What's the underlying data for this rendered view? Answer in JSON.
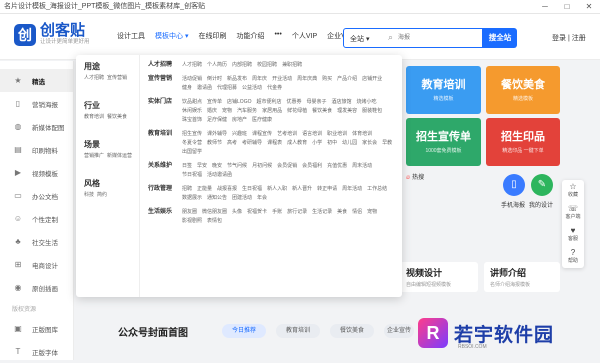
{
  "window": {
    "title": "名片设计模板_海报设计_PPT模板_微信图片_模板素材库_创客贴",
    "min": "─",
    "max": "□",
    "close": "✕"
  },
  "logo": {
    "mark": "创",
    "name": "创客贴",
    "slogan": "让设计更简单更好用"
  },
  "nav": [
    {
      "label": "设计工具"
    },
    {
      "label": "模板中心 ▾",
      "active": true
    },
    {
      "label": "在线印刷"
    },
    {
      "label": "功能介绍"
    },
    {
      "label": "•••"
    },
    {
      "label": "个人VIP"
    },
    {
      "label": "企业VIP"
    }
  ],
  "search": {
    "scope": "全站 ▾",
    "placeholder": "海报",
    "button": "搜全站"
  },
  "account": {
    "login": "登录",
    "sep": "|",
    "register": "注册"
  },
  "sidebar": {
    "items": [
      {
        "icon": "★",
        "label": "精选",
        "active": true
      },
      {
        "icon": "▯",
        "label": "营销海报"
      },
      {
        "icon": "◍",
        "label": "新媒体配图"
      },
      {
        "icon": "▤",
        "label": "印刷物料"
      },
      {
        "icon": "▶",
        "label": "视频模板"
      },
      {
        "icon": "▭",
        "label": "办公文档"
      },
      {
        "icon": "☺",
        "label": "个性定制"
      },
      {
        "icon": "♣",
        "label": "社交生活"
      },
      {
        "icon": "⊞",
        "label": "电商设计"
      },
      {
        "icon": "◉",
        "label": "原创插画"
      }
    ],
    "sub_title": "版权资源",
    "sub_items": [
      {
        "icon": "▣",
        "label": "正版图库"
      },
      {
        "icon": "T",
        "label": "正版字体"
      }
    ]
  },
  "menu": {
    "categories": [
      {
        "title": "用途",
        "subs": [
          "人才招聘",
          "宣传营销"
        ]
      },
      {
        "title": "行业",
        "subs": [
          "教育培训",
          "餐饮美食"
        ]
      },
      {
        "title": "场景",
        "subs": [
          "营销推广",
          "新媒体运营"
        ]
      },
      {
        "title": "风格",
        "subs": [
          "科技",
          "简约"
        ]
      }
    ],
    "groups": [
      {
        "title": "人才招聘",
        "items": [
          "人才招聘",
          "个人简历",
          "内部招聘",
          "校园招聘",
          "兼职招聘"
        ]
      },
      {
        "title": "宣传营销",
        "items": [
          "活动促销",
          "倒计时",
          "新品发布",
          "周年庆",
          "开业活动",
          "周年庆典",
          "购买",
          "产品介绍",
          "店铺开业",
          "健身",
          "邀请函",
          "代理招募",
          "公益活动",
          "代金券"
        ]
      },
      {
        "title": "实体门店",
        "items": [
          "饮品甜点",
          "宣传单",
          "店铺LOGO",
          "超市便利店",
          "优惠券",
          "母婴亲子",
          "酒店旅馆",
          "烧烤小吃",
          "休闲娱乐",
          "婚庆",
          "宠物",
          "汽车服务",
          "家居用品",
          "鲜花绿植",
          "餐饮美食",
          "理发美容",
          "服装鞋包",
          "珠宝首饰",
          "足疗保健",
          "房地产",
          "医疗健康"
        ]
      },
      {
        "title": "教育培训",
        "items": [
          "招生宣传",
          "课外辅导",
          "兴趣班",
          "课程宣传",
          "艺考培训",
          "语言培训",
          "职业培训",
          "体育培训",
          "冬夏令营",
          "教师节",
          "高考",
          "考研辅导",
          "课程表",
          "成人教育",
          "小学",
          "初中",
          "幼儿园",
          "家长会",
          "早教",
          "出国留学"
        ]
      },
      {
        "title": "关系维护",
        "items": [
          "日签",
          "早安",
          "晚安",
          "节气问候",
          "月初问候",
          "会员促销",
          "会员福利",
          "充值优惠",
          "周末活动",
          "节日祝福",
          "活动邀请函"
        ]
      },
      {
        "title": "行政管理",
        "items": [
          "招聘",
          "正能量",
          "战报喜报",
          "生日祝福",
          "新人入职",
          "新人晋升",
          "转正申请",
          "周年活动",
          "工作总结",
          "数据展示",
          "通知公告",
          "团建活动",
          "年会"
        ]
      },
      {
        "title": "生活娱乐",
        "items": [
          "朋友圈",
          "微信朋友圈",
          "头像",
          "祝福贺卡",
          "手账",
          "旅行记录",
          "生活记录",
          "美食",
          "情侣",
          "宠物",
          "影视剧照",
          "表情包"
        ]
      }
    ]
  },
  "banners": [
    {
      "title": "教育培训",
      "sub": "精选模板",
      "color": "#3a9cf2"
    },
    {
      "title": "餐饮美食",
      "sub": "精选模板",
      "color": "#f59a2e"
    },
    {
      "title": "招生宣传单",
      "sub": "1000套免费模板",
      "color": "#2ea86a"
    },
    {
      "title": "招生印品",
      "sub": "精选印品 一键下单",
      "color": "#e3423a"
    }
  ],
  "hot": {
    "label": "热搜"
  },
  "quick": [
    {
      "icon": "▯",
      "label": "手机海报"
    },
    {
      "icon": "✎",
      "label": "我的设计"
    }
  ],
  "float": [
    {
      "icon": "☆",
      "label": "收藏"
    },
    {
      "icon": "☏",
      "label": "客户端"
    },
    {
      "icon": "♥",
      "label": "客服"
    },
    {
      "icon": "?",
      "label": "帮助"
    }
  ],
  "cards": [
    {
      "title": "视频设计",
      "sub": "自由编辑短视频模板"
    },
    {
      "title": "讲师介绍",
      "sub": "名师介绍海报模板"
    }
  ],
  "section": {
    "title": "公众号封面首图",
    "tabs": [
      "今日推荐",
      "教育培训",
      "餐饮美食",
      "企业宣传"
    ]
  },
  "watermark": {
    "mark": "R",
    "text": "若宇软件园",
    "url": "RBSOI.COM"
  }
}
